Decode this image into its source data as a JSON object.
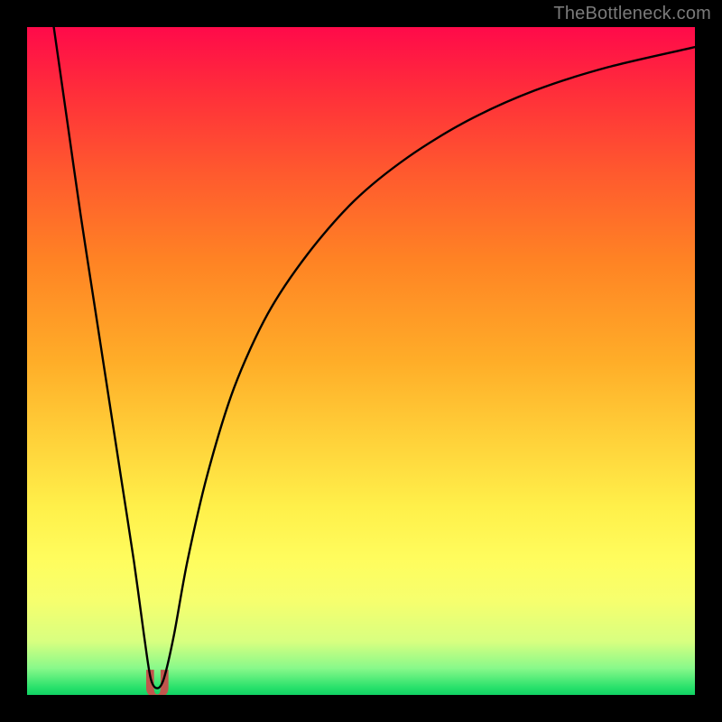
{
  "watermark": "TheBottleneck.com",
  "chart_data": {
    "type": "line",
    "title": "",
    "xlabel": "",
    "ylabel": "",
    "xlim": [
      0,
      100
    ],
    "ylim": [
      0,
      100
    ],
    "series": [
      {
        "name": "bottleneck-curve",
        "x": [
          4,
          6,
          8,
          10,
          12,
          14,
          16,
          17.5,
          18.5,
          19.5,
          20.5,
          22,
          24,
          27,
          31,
          36,
          42,
          49,
          57,
          66,
          76,
          87,
          100
        ],
        "values": [
          100,
          86,
          72,
          59,
          46,
          33,
          20,
          9,
          2.5,
          1.0,
          2.5,
          9,
          20,
          33,
          46,
          57,
          66,
          74,
          80.5,
          86,
          90.5,
          94,
          97
        ]
      }
    ],
    "marker": {
      "x_center": 19.5,
      "y_center": 1.5,
      "width": 3.2,
      "height": 4.0,
      "color": "#c1564d"
    },
    "colors": {
      "curve": "#000000",
      "marker": "#c1564d",
      "background_top": "#ff0a4a",
      "background_bottom": "#11d264",
      "frame": "#000000"
    }
  }
}
